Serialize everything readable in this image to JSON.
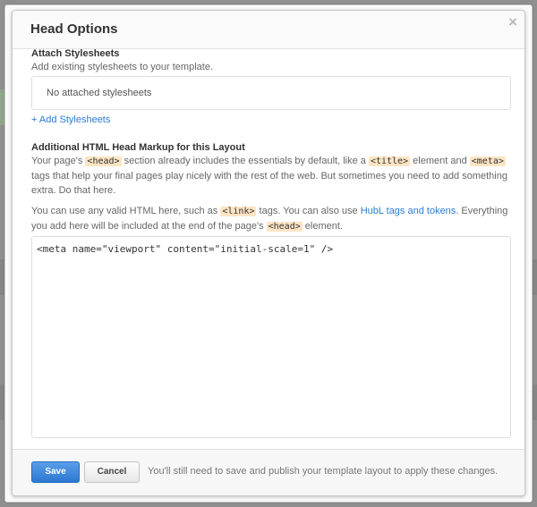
{
  "modal": {
    "title": "Head Options",
    "close_glyph": "×"
  },
  "stylesheets": {
    "title": "Attach Stylesheets",
    "subtitle": "Add existing stylesheets to your template.",
    "empty_text": "No attached stylesheets",
    "add_link": "+ Add Stylesheets"
  },
  "head_markup": {
    "title": "Additional HTML Head Markup for this Layout",
    "para1": {
      "t1": "Your page's ",
      "code1": "<head>",
      "t2": " section already includes the essentials by default, like a ",
      "code2": "<title>",
      "t3": " element and ",
      "code3": "<meta>",
      "t4": " tags that help your final pages play nicely with the rest of the web. But sometimes you need to add something extra. Do that here."
    },
    "para2": {
      "t1": "You can use any valid HTML here, such as ",
      "code1": "<link>",
      "t2": " tags. You can also use ",
      "link": "HubL tags and tokens",
      "t3": ". Everything you add here will be included at the end of the page's ",
      "code2": "<head>",
      "t4": " element."
    },
    "code_value": "<meta name=\"viewport\" content=\"initial-scale=1\" />"
  },
  "footer": {
    "save_label": "Save",
    "cancel_label": "Cancel",
    "note": "You'll still need to save and publish your template layout to apply these changes."
  },
  "colors": {
    "accent": "#2b7bd3",
    "code_highlight": "#fde4c4"
  }
}
